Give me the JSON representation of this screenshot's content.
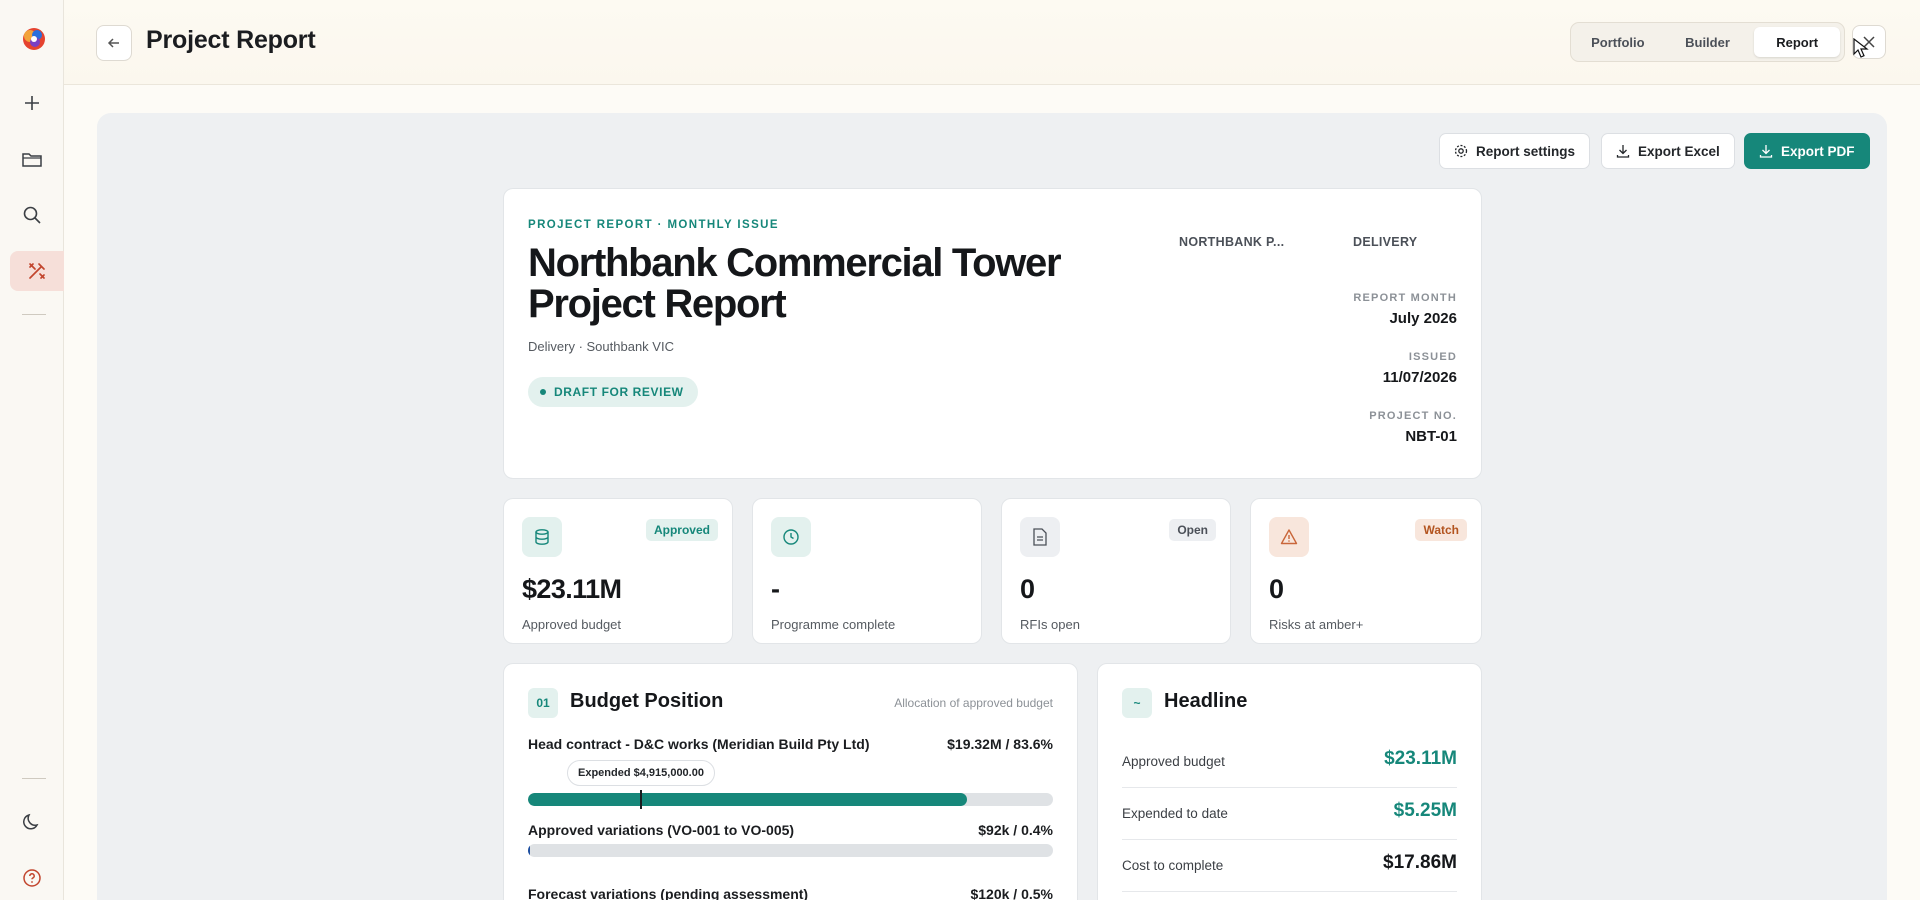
{
  "header": {
    "title": "Project Report"
  },
  "view_switch": {
    "options": [
      "Portfolio",
      "Builder",
      "Report"
    ],
    "active": "Report"
  },
  "toolbar": {
    "settings_label": "Report settings",
    "excel_label": "Export Excel",
    "pdf_label": "Export PDF"
  },
  "hero": {
    "eyebrow": "PROJECT REPORT · MONTHLY ISSUE",
    "title": "Northbank Commercial Tower Project Report",
    "subtitle": "Delivery · Southbank VIC",
    "status": "DRAFT FOR REVIEW",
    "client": "NORTHBANK P...",
    "phase": "DELIVERY",
    "report_month_label": "REPORT MONTH",
    "report_month": "July 2026",
    "issued_label": "ISSUED",
    "issued": "11/07/2026",
    "project_no_label": "PROJECT NO.",
    "project_no": "NBT-01"
  },
  "kpis": [
    {
      "icon": "database-icon",
      "badge": "Approved",
      "value": "$23.11M",
      "label": "Approved budget"
    },
    {
      "icon": "clock-icon",
      "badge": "",
      "value": "-",
      "label": "Programme complete"
    },
    {
      "icon": "document-icon",
      "badge": "Open",
      "value": "0",
      "label": "RFIs open"
    },
    {
      "icon": "warning-icon",
      "badge": "Watch",
      "value": "0",
      "label": "Risks at amber+"
    }
  ],
  "budget": {
    "num": "01",
    "title": "Budget Position",
    "hint": "Allocation of approved budget",
    "lines": [
      {
        "label": "Head contract - D&C works (Meridian Build Pty Ltd)",
        "amount": "$19.32M / 83.6%",
        "percent": 83.6,
        "expended_tip": "Expended $4,915,000.00",
        "expended_percent": 21.3
      },
      {
        "label": "Approved variations (VO-001 to VO-005)",
        "amount": "$92k / 0.4%",
        "percent": 0.4
      },
      {
        "label": "Forecast variations (pending assessment)",
        "amount": "$120k / 0.5%",
        "percent": 0.5
      }
    ]
  },
  "headline": {
    "num": "~",
    "title": "Headline",
    "rows": [
      {
        "label": "Approved budget",
        "value": "$23.11M",
        "color": "#16877a"
      },
      {
        "label": "Expended to date",
        "value": "$5.25M",
        "color": "#16877a"
      },
      {
        "label": "Cost to complete",
        "value": "$17.86M",
        "color": "#15171a"
      }
    ]
  }
}
